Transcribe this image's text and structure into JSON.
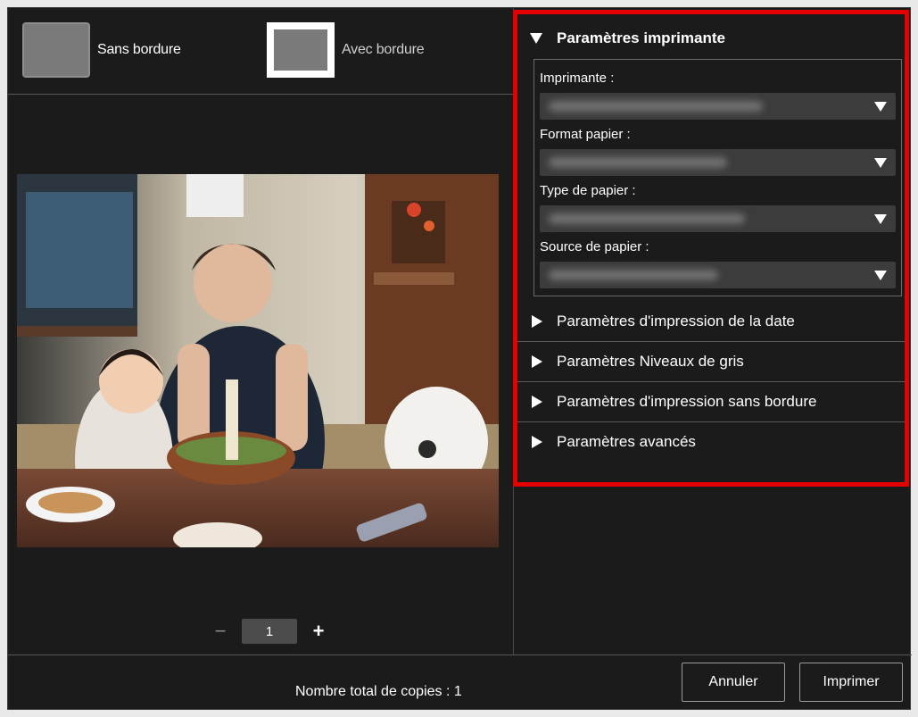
{
  "layout": {
    "borderless_label": "Sans bordure",
    "bordered_label": "Avec bordure"
  },
  "copies": {
    "value": "1",
    "minus": "−",
    "plus": "+"
  },
  "printer_settings": {
    "title": "Paramètres imprimante",
    "fields": [
      {
        "label": "Imprimante :"
      },
      {
        "label": "Format papier :"
      },
      {
        "label": "Type de papier :"
      },
      {
        "label": "Source de papier :"
      }
    ]
  },
  "sections": [
    {
      "label": "Paramètres d'impression de la date"
    },
    {
      "label": "Paramètres Niveaux de gris"
    },
    {
      "label": "Paramètres d'impression sans bordure"
    },
    {
      "label": "Paramètres avancés"
    }
  ],
  "footer": {
    "total_label": "Nombre total de copies : 1",
    "cancel_label": "Annuler",
    "print_label": "Imprimer"
  },
  "colors": {
    "highlight": "#e50000",
    "background": "#1b1b1b"
  }
}
